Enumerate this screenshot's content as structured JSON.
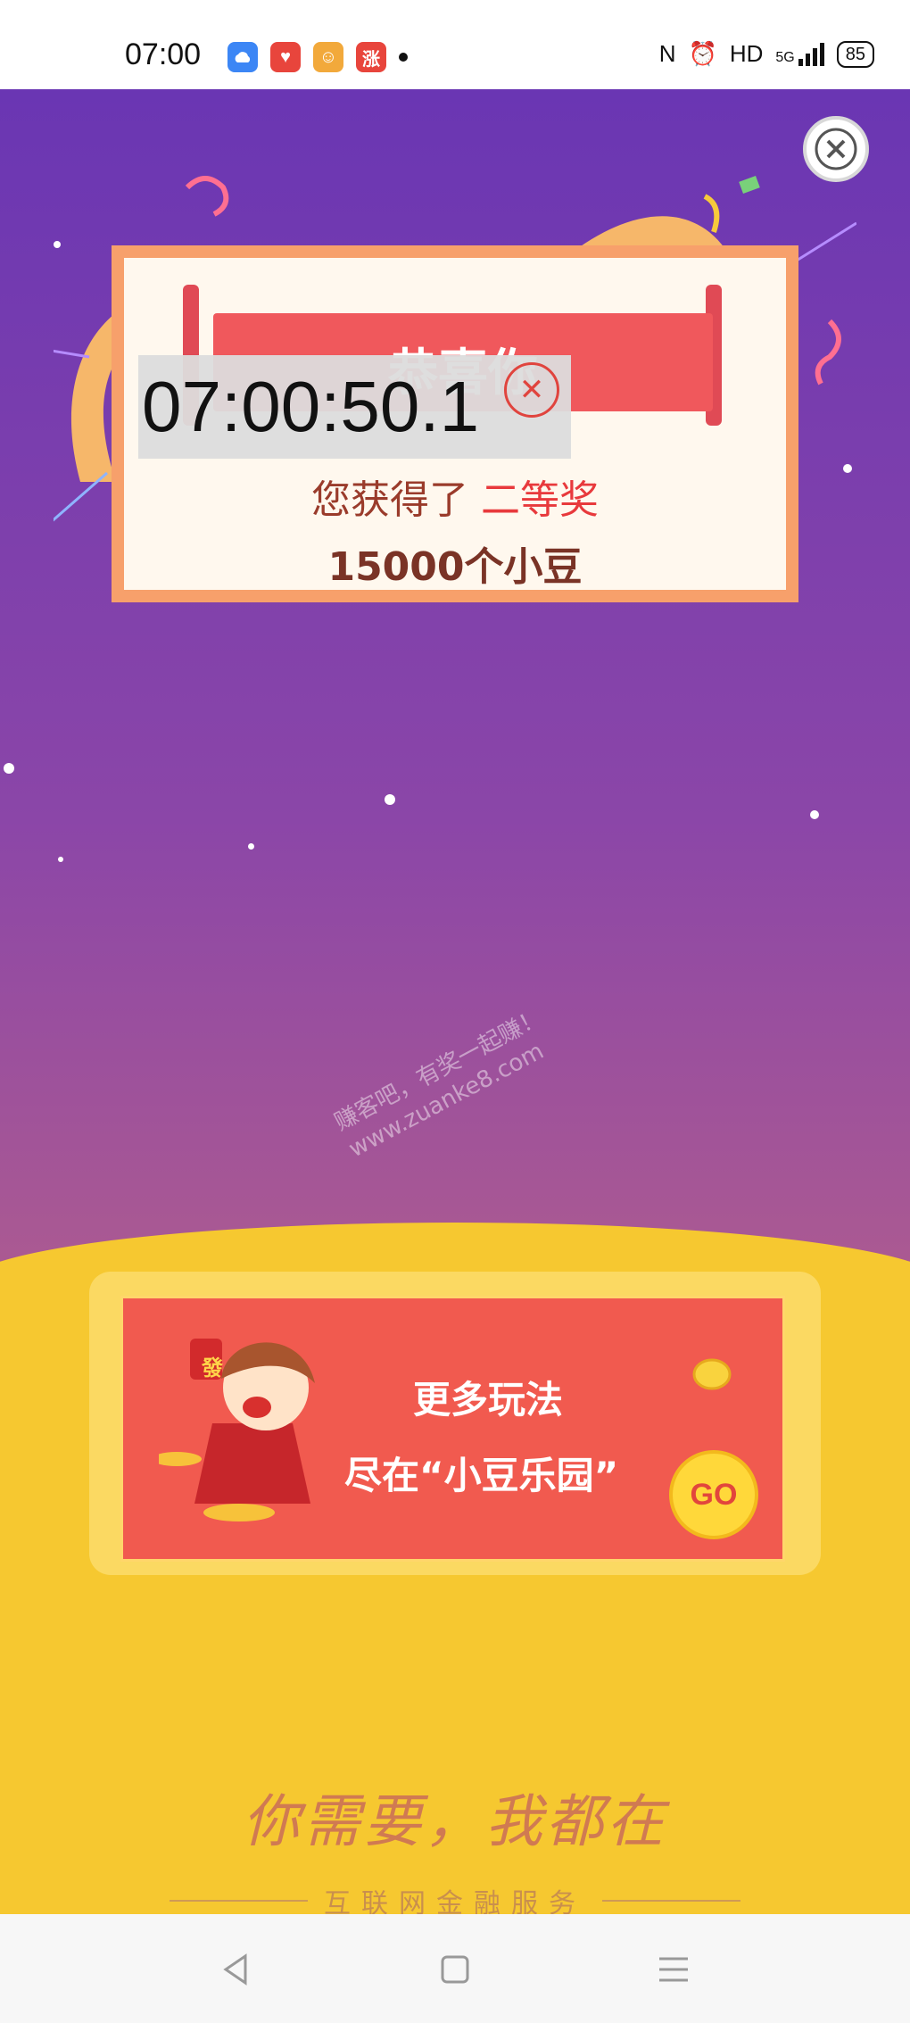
{
  "status_bar": {
    "time": "07:00",
    "app_icons": [
      "cloud-app-icon",
      "heart-app-icon",
      "cartoon-app-icon",
      "zhang-app-icon"
    ],
    "zhang_icon_text": "涨",
    "network": "HD",
    "signal": "5G",
    "battery": "85"
  },
  "prize_dialog": {
    "title": "恭喜你",
    "won_prefix": "您获得了",
    "prize_rank": "二等奖",
    "reward": "15000个小豆"
  },
  "timer_overlay": {
    "time": "07:00:50.1"
  },
  "watermark": {
    "line1": "赚客吧，有奖一起赚！",
    "line2": "www.zuanke8.com"
  },
  "promo": {
    "line1": "更多玩法",
    "line2": "尽在“小豆乐园”",
    "go_label": "GO",
    "character_badge": "發"
  },
  "footer": {
    "slogan": "你需要，我都在",
    "tagline": "互联网金融服务"
  },
  "colors": {
    "bg_top": "#6a36b3",
    "bg_bottom": "#c86a85",
    "card_border": "#f7a06b",
    "banner": "#f0585c",
    "promo_card": "#f15a4f",
    "yellow": "#f6c830"
  }
}
